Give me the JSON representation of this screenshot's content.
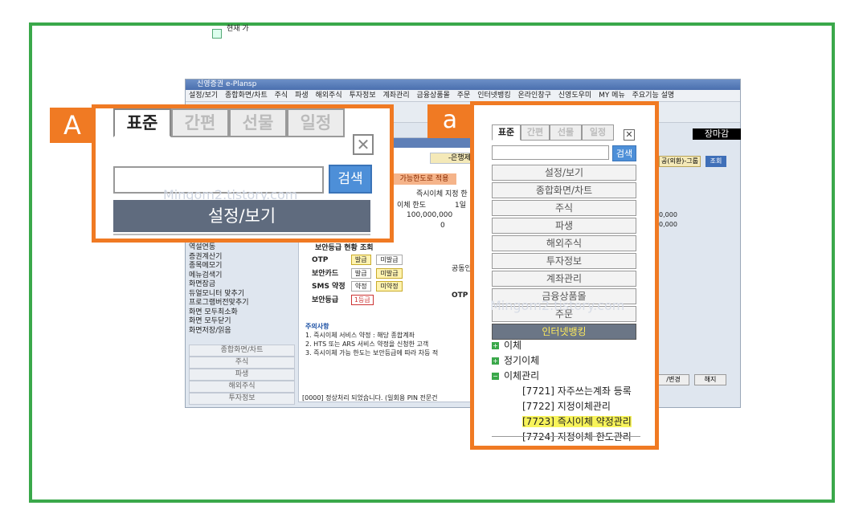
{
  "app": {
    "title": "신영증권 e-Plansp",
    "menu": [
      "설정/보기",
      "종합화면/차트",
      "주식",
      "파생",
      "해외주식",
      "투자정보",
      "계좌관리",
      "금융상품몰",
      "주문",
      "인터넷뱅킹",
      "온라인창구",
      "신영도우미",
      "MY 메뉴",
      "주요기능 설명"
    ],
    "toolbar_text": "현재\n가",
    "left_list": [
      "역설연동",
      "증권계산기",
      "종목메모기",
      "메뉴검색기",
      "화면잠금",
      "듀얼모니터 맞추기",
      "프로그램버전맞추기",
      "화면 모두최소화",
      "화면 모두닫기",
      "화면저장/읽음"
    ],
    "left_tabs": [
      "종합화면/차트",
      "주식",
      "파생",
      "해외주식",
      "투자정보"
    ],
    "bank_label": "-은행제휴",
    "limit_button": "가능한도로 적용",
    "instant_transfer_label": "즉시이체 지정 한",
    "transfer_limit_label": "이체 한도",
    "first_col": "1일",
    "limit_value": "100,000,000",
    "zero_value": "0",
    "security_title": "보안등급 현황 조회",
    "security_rows": [
      {
        "label": "OTP",
        "opt1": "발급",
        "opt2": "미발급"
      },
      {
        "label": "보안카드",
        "opt1": "발급",
        "opt2": "미발급"
      },
      {
        "label": "SMS 약정",
        "opt1": "약정",
        "opt2": "미약정"
      },
      {
        "label": "보안등급",
        "grade": "1등급"
      }
    ],
    "notice_title": "주의사항",
    "notice_lines": [
      "1. 즉시이체 서비스 약정 : 해당 종합계좌",
      "2. HTS 또는 ARS 서비스 약정을 신청한 고객",
      "3. 즉시이체 가능 한도는 보안등급에 따라 차등 적"
    ],
    "status_text": "[0000] 정상처리 되었습니다. (일회용 PIN 전문건",
    "right_title": "장마감",
    "right_btn1": "공(외환)-그룹",
    "right_btn2": "조회",
    "right_nums": [
      "0,000",
      "0,000"
    ],
    "right_btn3": "/변경",
    "right_btn4": "해지",
    "popup_labels": [
      "공동인",
      "OTP"
    ]
  },
  "callout_a": {
    "badge": "A",
    "tabs": [
      "표준",
      "간편",
      "선물",
      "일정"
    ],
    "close": "✕",
    "search_button": "검색",
    "first_menu": "설정/보기",
    "watermark": "Mingom2.tistory.com"
  },
  "callout_b": {
    "badge": "a",
    "tabs": [
      "표준",
      "간편",
      "선물",
      "일정"
    ],
    "close": "✕",
    "search_button": "검색",
    "menu": [
      "설정/보기",
      "종합화면/차트",
      "주식",
      "파생",
      "해외주식",
      "투자정보",
      "계좌관리",
      "금융상품몰",
      "주문",
      "인터넷뱅킹"
    ],
    "tree": {
      "transfer": "이체",
      "regular_transfer": "정기이체",
      "transfer_management": "이체관리",
      "leaves": [
        "[7721] 자주쓰는계좌 등록",
        "[7722] 지정이체관리",
        "[7723] 즉시이체 약정관리",
        "[7724] 지정이체 한도관리"
      ]
    },
    "watermark": "Mingom2.tistory.com"
  },
  "colors": {
    "frame": "#3aa84a",
    "callout": "#f07a23",
    "highlight": "#f7f35a",
    "search": "#4d8fd8"
  }
}
